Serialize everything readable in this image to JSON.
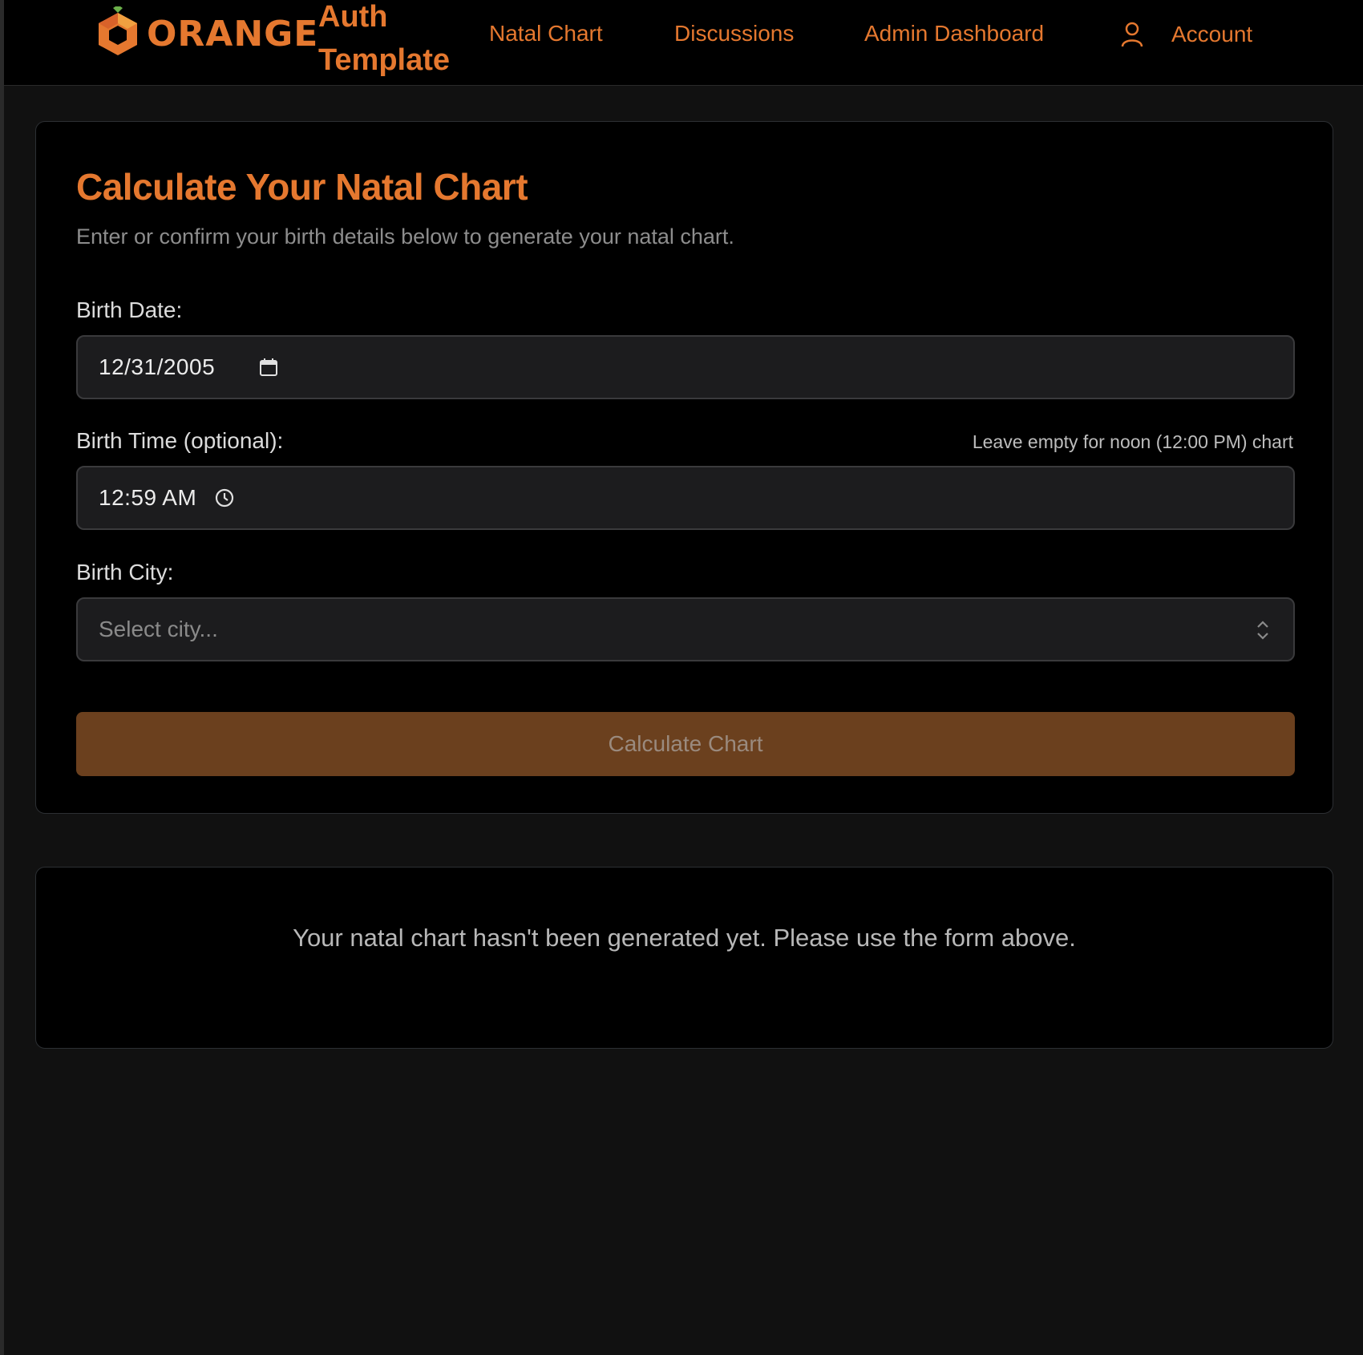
{
  "nav": {
    "logo_text": "ORANGE",
    "brand_line1": "Auth",
    "brand_line2": "Template",
    "links": [
      "Natal Chart",
      "Discussions",
      "Admin Dashboard"
    ],
    "account_label": "Account",
    "account_icon": "user-icon"
  },
  "form": {
    "title": "Calculate Your Natal Chart",
    "subtitle": "Enter or confirm your birth details below to generate your natal chart.",
    "birth_date": {
      "label": "Birth Date:",
      "value": "12/31/2005",
      "icon": "calendar-icon"
    },
    "birth_time": {
      "label": "Birth Time (optional):",
      "hint": "Leave empty for noon (12:00 PM) chart",
      "value": "12:59 AM",
      "icon": "clock-icon"
    },
    "birth_city": {
      "label": "Birth City:",
      "placeholder": "Select city...",
      "icon": "chevron-up-down-icon"
    },
    "submit_label": "Calculate Chart"
  },
  "empty_state": {
    "message": "Your natal chart hasn't been generated yet. Please use the form above."
  },
  "colors": {
    "accent": "#e5782f",
    "button_disabled": "#6b401e",
    "card_bg": "#000000",
    "page_bg": "#111111"
  }
}
